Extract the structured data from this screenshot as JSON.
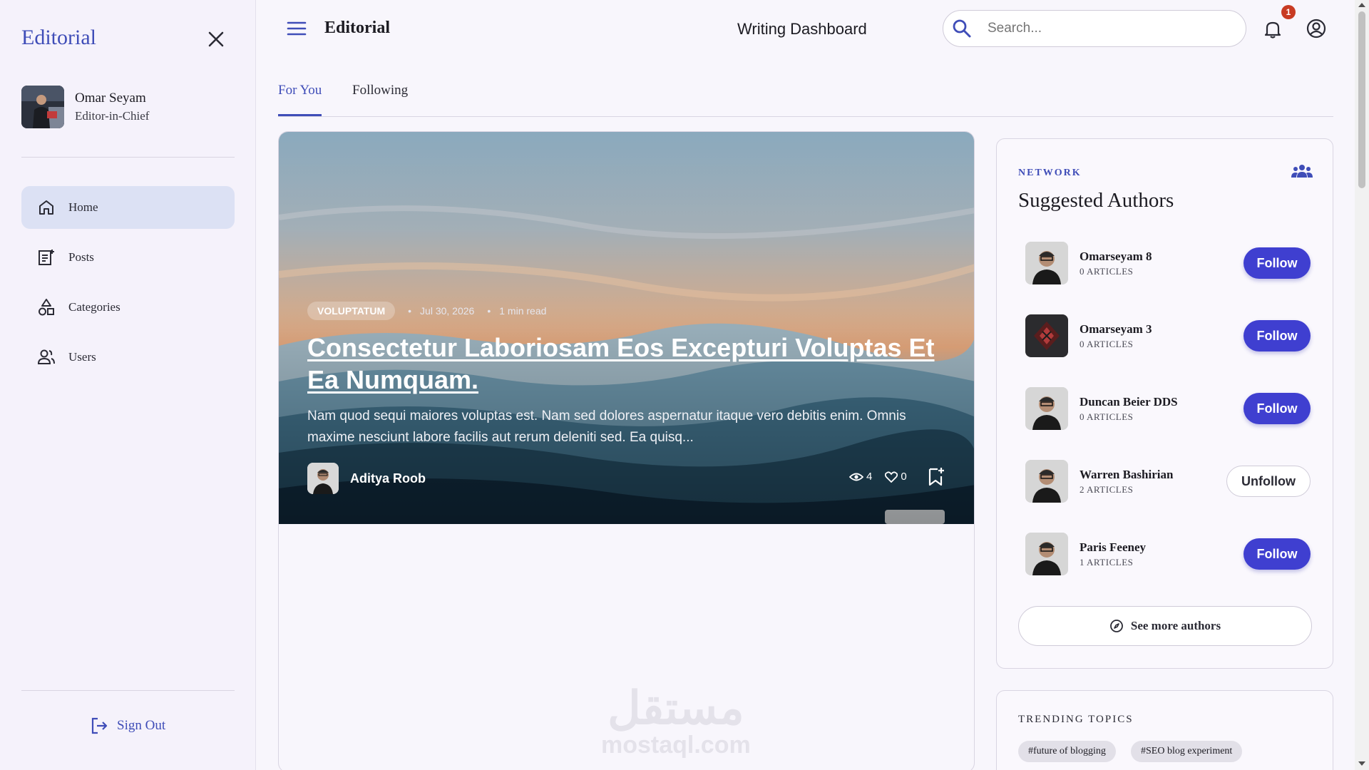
{
  "sidebar": {
    "brand": "Editorial",
    "user": {
      "name": "Omar Seyam",
      "role": "Editor-in-Chief"
    },
    "nav": [
      {
        "label": "Home",
        "icon": "home-icon",
        "active": true
      },
      {
        "label": "Posts",
        "icon": "posts-icon",
        "active": false
      },
      {
        "label": "Categories",
        "icon": "categories-icon",
        "active": false
      },
      {
        "label": "Users",
        "icon": "users-icon",
        "active": false
      }
    ],
    "sign_out": "Sign Out"
  },
  "header": {
    "title": "Editorial",
    "center_title": "Writing Dashboard",
    "search_placeholder": "Search...",
    "notification_count": "1"
  },
  "tabs": [
    {
      "label": "For You",
      "active": true
    },
    {
      "label": "Following",
      "active": false
    }
  ],
  "featured": {
    "category": "VOLUPTATUM",
    "date": "Jul 30, 2026",
    "read_time": "1 min read",
    "title": "Consectetur Laboriosam Eos Excepturi Voluptas Et Ea Numquam.",
    "excerpt": "Nam quod sequi maiores voluptas est. Nam sed dolores aspernatur itaque vero debitis enim. Omnis maxime nesciunt labore facilis aut rerum deleniti sed. Ea quisq...",
    "author": "Aditya Roob",
    "views": "4",
    "likes": "0"
  },
  "watermark": {
    "arabic": "مستقل",
    "latin": "mostaql.com"
  },
  "suggested": {
    "overline": "NETWORK",
    "title": "Suggested Authors",
    "authors": [
      {
        "name": "Omarseyam 8",
        "articles": "0 ARTICLES",
        "action": "Follow"
      },
      {
        "name": "Omarseyam 3",
        "articles": "0 ARTICLES",
        "action": "Follow"
      },
      {
        "name": "Duncan Beier DDS",
        "articles": "0 ARTICLES",
        "action": "Follow"
      },
      {
        "name": "Warren Bashirian",
        "articles": "2 ARTICLES",
        "action": "Unfollow"
      },
      {
        "name": "Paris Feeney",
        "articles": "1 ARTICLES",
        "action": "Follow"
      }
    ],
    "see_more": "See more authors"
  },
  "trending": {
    "overline": "TRENDING TOPICS",
    "topics": [
      "#future of blogging",
      "#SEO blog experiment"
    ]
  },
  "colors": {
    "accent": "#3f4db8",
    "button": "#3f3fd0",
    "badge": "#c83b23"
  }
}
